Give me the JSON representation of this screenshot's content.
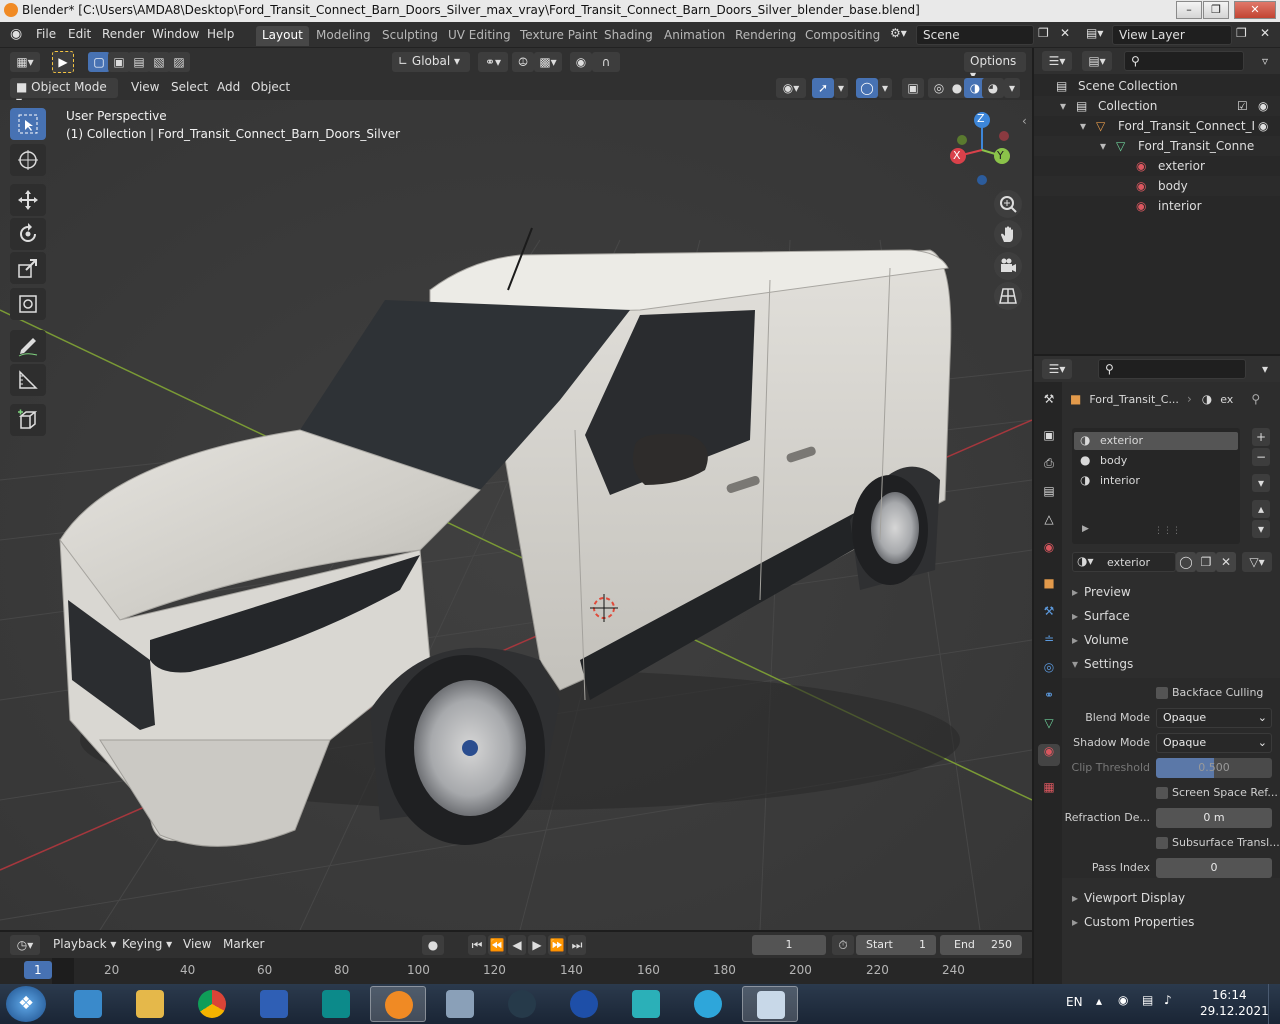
{
  "window": {
    "title": "Blender* [C:\\Users\\AMDA8\\Desktop\\Ford_Transit_Connect_Barn_Doors_Silver_max_vray\\Ford_Transit_Connect_Barn_Doors_Silver_blender_base.blend]"
  },
  "menu": [
    "File",
    "Edit",
    "Render",
    "Window",
    "Help"
  ],
  "workspaces": [
    "Layout",
    "Modeling",
    "Sculpting",
    "UV Editing",
    "Texture Paint",
    "Shading",
    "Animation",
    "Rendering",
    "Compositing"
  ],
  "scene_field": "Scene",
  "view_layer_field": "View Layer",
  "tool_header": {
    "orientation": "Global",
    "options": "Options"
  },
  "viewport_header": {
    "mode": "Object Mode",
    "menus": [
      "View",
      "Select",
      "Add",
      "Object"
    ]
  },
  "viewport": {
    "perspective": "User Perspective",
    "collection_info": "(1) Collection | Ford_Transit_Connect_Barn_Doors_Silver",
    "gizmo_axes": {
      "x": "X",
      "y": "Y",
      "z": "Z"
    }
  },
  "timeline": {
    "menus": [
      "Playback",
      "Keying",
      "View",
      "Marker"
    ],
    "current_frame": "1",
    "start_label": "Start",
    "start_value": "1",
    "end_label": "End",
    "end_value": "250",
    "ticks": [
      "1",
      "20",
      "40",
      "60",
      "80",
      "100",
      "120",
      "140",
      "160",
      "180",
      "200",
      "220",
      "240"
    ]
  },
  "outliner": {
    "scene_collection": "Scene Collection",
    "collection": "Collection",
    "object": "Ford_Transit_Connect_I",
    "mesh": "Ford_Transit_Conne",
    "materials": [
      "exterior",
      "body",
      "interior"
    ]
  },
  "properties": {
    "object_name": "Ford_Transit_C...",
    "material_short": "ex",
    "material_slots": [
      "exterior",
      "body",
      "interior"
    ],
    "active_material": "exterior",
    "panels": {
      "preview": "Preview",
      "surface": "Surface",
      "volume": "Volume",
      "settings": "Settings",
      "viewport_display": "Viewport Display",
      "custom_properties": "Custom Properties"
    },
    "settings": {
      "backface_culling": "Backface Culling",
      "blend_mode_label": "Blend Mode",
      "blend_mode_value": "Opaque",
      "shadow_mode_label": "Shadow Mode",
      "shadow_mode_value": "Opaque",
      "clip_threshold_label": "Clip Threshold",
      "clip_threshold_value": "0.500",
      "screen_space_refraction": "Screen Space Ref...",
      "refraction_depth_label": "Refraction De...",
      "refraction_depth_value": "0 m",
      "subsurface_translucency": "Subsurface Transl...",
      "pass_index_label": "Pass Index",
      "pass_index_value": "0"
    }
  },
  "taskbar": {
    "language": "EN",
    "time": "16:14",
    "date": "29.12.2021"
  },
  "colors": {
    "accent": "#4772b3",
    "header": "#303030",
    "viewport_bg": "#3a3a3a",
    "axis_x": "#d9414a",
    "axis_y": "#8bc34a",
    "axis_z": "#3d86d9"
  }
}
